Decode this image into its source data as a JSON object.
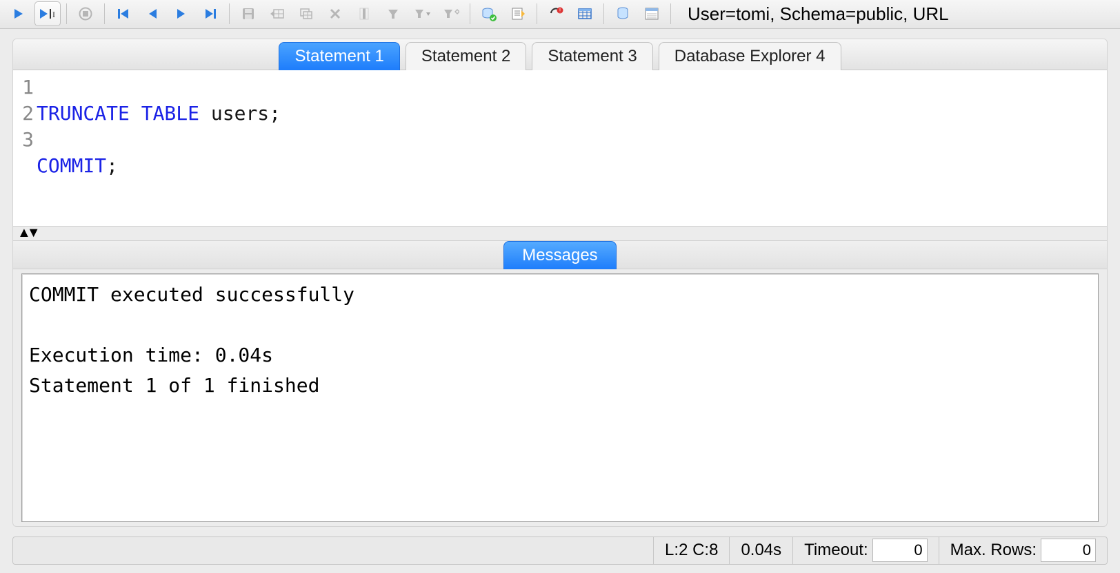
{
  "toolbar": {
    "status_text": "User=tomi, Schema=public, URL"
  },
  "tabs": [
    {
      "label": "Statement 1",
      "active": true
    },
    {
      "label": "Statement 2",
      "active": false
    },
    {
      "label": "Statement 3",
      "active": false
    },
    {
      "label": "Database Explorer 4",
      "active": false
    }
  ],
  "editor": {
    "lines": [
      {
        "n": "1",
        "kw": "TRUNCATE TABLE",
        "rest": " users;"
      },
      {
        "n": "2",
        "kw": "COMMIT",
        "rest": ";"
      },
      {
        "n": "3",
        "kw": "",
        "rest": ""
      }
    ]
  },
  "messages": {
    "tab_label": "Messages",
    "text": "COMMIT executed successfully\n\nExecution time: 0.04s\nStatement 1 of 1 finished"
  },
  "status": {
    "cursor": "L:2 C:8",
    "exec_time": "0.04s",
    "timeout_label": "Timeout:",
    "timeout_value": "0",
    "maxrows_label": "Max. Rows:",
    "maxrows_value": "0"
  }
}
